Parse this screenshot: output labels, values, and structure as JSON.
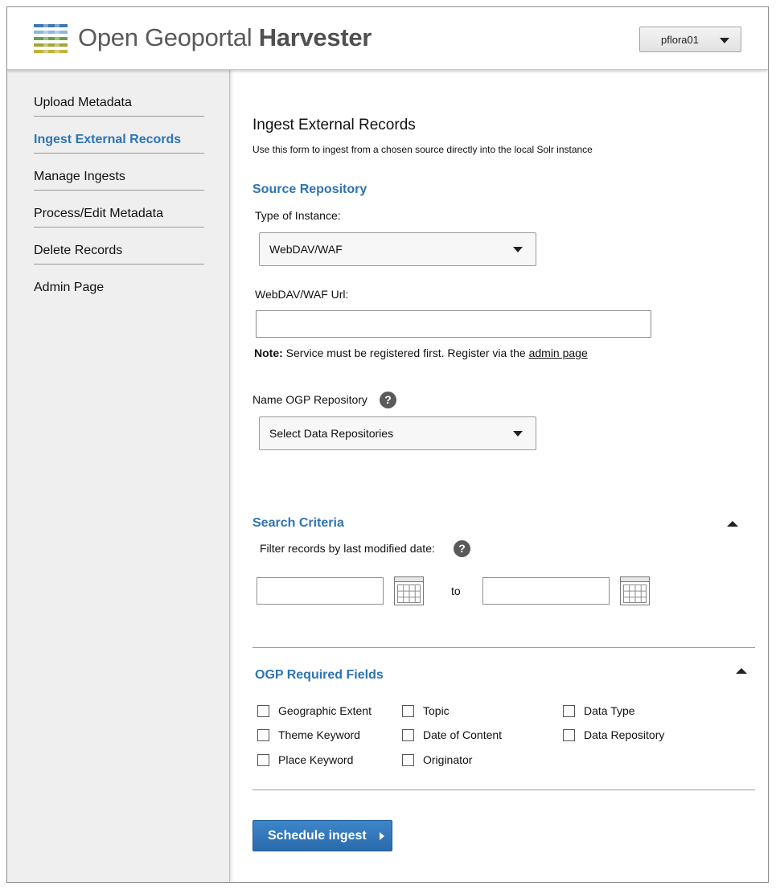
{
  "header": {
    "logo_part1": "Open Geoportal ",
    "logo_part2": "Harvester",
    "logo_icon": "logo-stripes-icon",
    "user_name": "pflora01"
  },
  "sidebar": {
    "items": [
      {
        "label": "Upload Metadata"
      },
      {
        "label": "Ingest External Records"
      },
      {
        "label": "Manage Ingests"
      },
      {
        "label": "Process/Edit Metadata"
      },
      {
        "label": "Delete Records"
      },
      {
        "label": "Admin Page"
      }
    ],
    "active_index": 1
  },
  "main": {
    "title": "Ingest External Records",
    "subtitle": "Use this form to ingest from a chosen source directly into the local Solr instance",
    "source": {
      "heading": "Source Repository",
      "type_label": "Type of Instance:",
      "type_value": "WebDAV/WAF",
      "url_label": "WebDAV/WAF Url:",
      "url_value": "",
      "note_bold": "Note:",
      "note_text": " Service must be registered first. Register via the ",
      "note_link": "admin page",
      "name_label": "Name OGP Repository",
      "name_value": "Select Data Repositories"
    },
    "search": {
      "heading": "Search Criteria",
      "filter_label": "Filter records by last  modified date:",
      "from_value": "",
      "to_label": "to",
      "to_value": ""
    },
    "required": {
      "heading": "OGP Required Fields",
      "columns": [
        [
          "Geographic Extent",
          "Theme Keyword",
          "Place Keyword"
        ],
        [
          "Topic",
          "Date of Content",
          "Originator"
        ],
        [
          "Data Type",
          "Data Repository"
        ]
      ]
    },
    "submit_label": "Schedule ingest",
    "help_symbol": "?"
  },
  "colors": {
    "accent": "#2d74b3",
    "sidebar_bg": "#efefef",
    "button": "#2f74b8"
  }
}
